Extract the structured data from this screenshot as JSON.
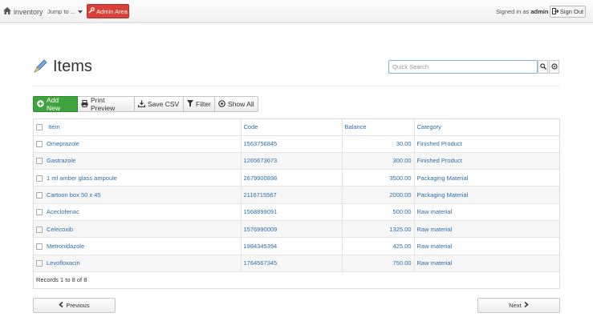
{
  "navbar": {
    "brand": "inventory",
    "jump": "Jump to ...",
    "admin": "Admin Area",
    "signed_prefix": "Signed in as",
    "user": "admin",
    "signout": "Sign Out"
  },
  "page": {
    "title": "Items",
    "search_placeholder": "Quick Search"
  },
  "toolbar": {
    "add": "Add New",
    "print": "Print Preview",
    "csv": "Save CSV",
    "filter": "Filter",
    "showall": "Show All"
  },
  "table": {
    "columns": [
      "Item",
      "Code",
      "Balance",
      "Category"
    ],
    "rows": [
      {
        "item": "Omeprazole",
        "code": "1563756845",
        "balance": "30.00",
        "category": "Finished Product"
      },
      {
        "item": "Gastrazole",
        "code": "1265673673",
        "balance": "300.00",
        "category": "Finished Product"
      },
      {
        "item": "1 ml amber glass ampoule",
        "code": "2679900898",
        "balance": "3500.00",
        "category": "Packaging Material"
      },
      {
        "item": "Cartoon box 50 x 45",
        "code": "2116715567",
        "balance": "2000.00",
        "category": "Packaging Material"
      },
      {
        "item": "Aceclofenac",
        "code": "1568899091",
        "balance": "500.00",
        "category": "Raw material"
      },
      {
        "item": "Celecoxib",
        "code": "1576990009",
        "balance": "1325.00",
        "category": "Raw material"
      },
      {
        "item": "Metronidazole",
        "code": "1984345394",
        "balance": "425.00",
        "category": "Raw material"
      },
      {
        "item": "Levofloxacin",
        "code": "1764567345",
        "balance": "750.00",
        "category": "Raw material"
      }
    ],
    "footer": "Records 1 to 8 of 8"
  },
  "pager": {
    "previous": "Previous",
    "next": "Next"
  },
  "colors": {
    "link": "#2a6fb0",
    "add_green": "#3fa33f",
    "admin_red": "#d9403a"
  }
}
